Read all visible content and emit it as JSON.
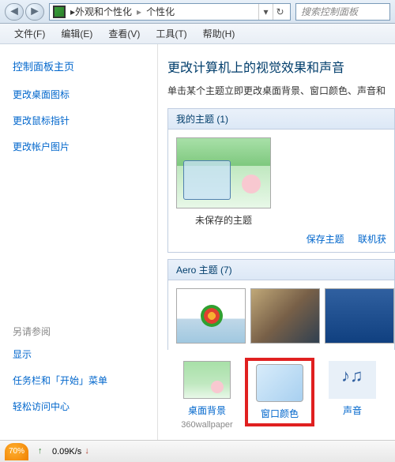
{
  "titlebar": {
    "breadcrumb": [
      "外观和个性化",
      "个性化"
    ],
    "search_placeholder": "搜索控制面板"
  },
  "menubar": [
    "文件(F)",
    "编辑(E)",
    "查看(V)",
    "工具(T)",
    "帮助(H)"
  ],
  "sidebar": {
    "home": "控制面板主页",
    "links": [
      "更改桌面图标",
      "更改鼠标指针",
      "更改帐户图片"
    ],
    "also_label": "另请参阅",
    "also": [
      "显示",
      "任务栏和「开始」菜单",
      "轻松访问中心"
    ]
  },
  "main": {
    "heading": "更改计算机上的视觉效果和声音",
    "desc": "单击某个主题立即更改桌面背景、窗口颜色、声音和",
    "my_themes_title": "我的主题 (1)",
    "unsaved_theme": "未保存的主题",
    "save_theme": "保存主题",
    "get_online": "联机获",
    "aero_title": "Aero 主题 (7)"
  },
  "options": {
    "bg": {
      "label": "桌面背景",
      "sub": "360wallpaper"
    },
    "color": {
      "label": "窗口颜色"
    },
    "sound": {
      "label": "声音"
    }
  },
  "statusbar": {
    "zoom": "70%",
    "net_speed": "0.09K/s"
  }
}
